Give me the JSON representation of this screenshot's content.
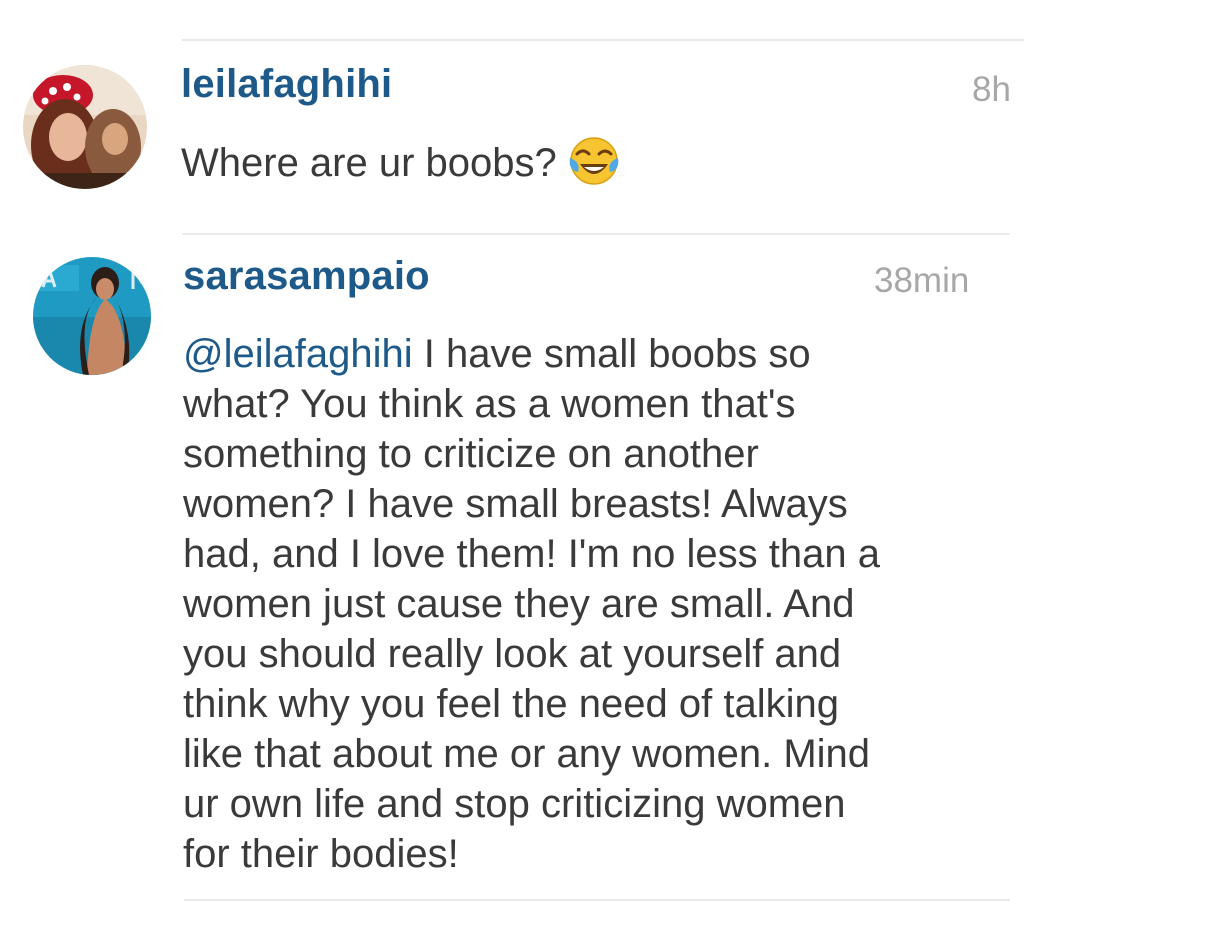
{
  "comments": [
    {
      "username": "leilafaghihi",
      "timestamp": "8h",
      "text": "Where are ur boobs?",
      "emoji": "face-with-tears-of-joy-icon"
    },
    {
      "username": "sarasampaio",
      "timestamp": "38min",
      "mention": "@leilafaghihi",
      "lines": [
        " I have small boobs so",
        "what? You think as a women that's",
        "something to criticize on another",
        "women? I have small breasts! Always",
        "had, and I love them! I'm no less than a",
        "women just cause they are small. And",
        "you should really look at yourself and",
        "think why you feel the need of talking",
        "like that about me or any women. Mind",
        "ur own life and stop criticizing women",
        "for their bodies!"
      ]
    }
  ],
  "colors": {
    "username": "#1d5a8a",
    "timestamp": "#a7a7a7",
    "text": "#3a3a3a",
    "divider": "#e9e9e9"
  }
}
